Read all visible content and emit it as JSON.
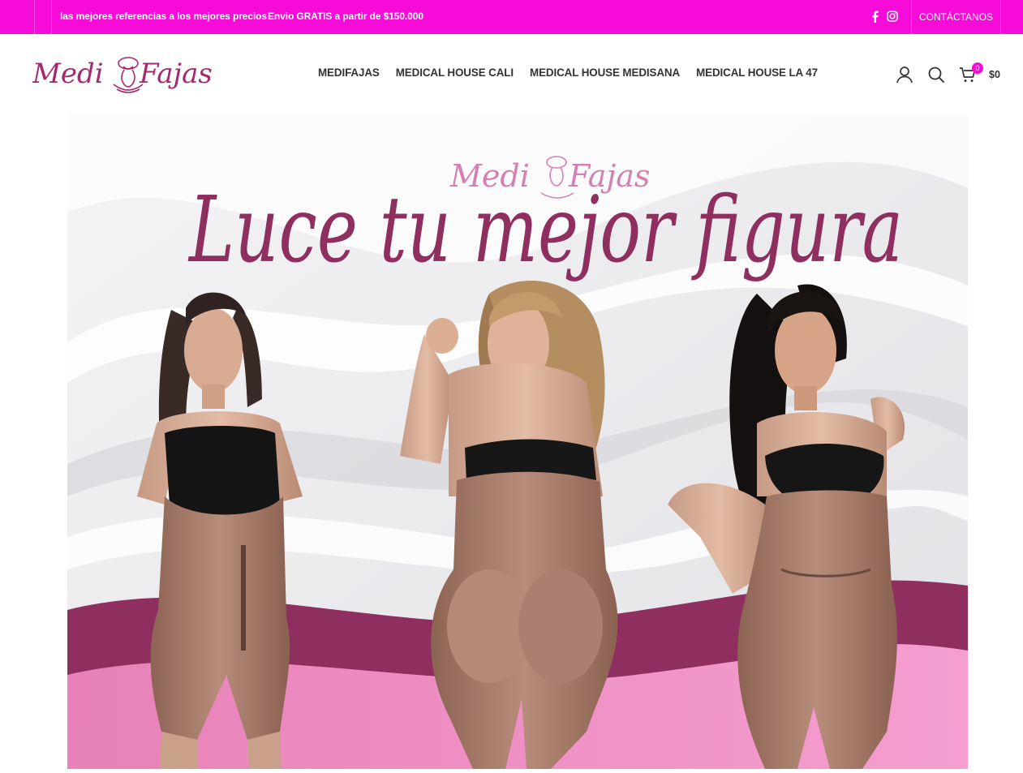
{
  "topbar": {
    "promo_left": "las mejores referencias a los mejores precios",
    "promo_right": "Envio GRATIS a partir de $150.000",
    "social": [
      "facebook-icon",
      "instagram-icon"
    ],
    "contact_label": "CONTÁCTANOS",
    "background": "#f70bd9"
  },
  "header": {
    "logo_text_left": "Medi",
    "logo_text_right": "Fajas",
    "nav": [
      {
        "label": "MEDIFAJAS"
      },
      {
        "label": "MEDICAL HOUSE CALI"
      },
      {
        "label": "MEDICAL HOUSE MEDISANA"
      },
      {
        "label": "MEDICAL HOUSE LA 47"
      }
    ],
    "icons": [
      "user-icon",
      "search-icon",
      "cart-icon"
    ],
    "cart_count": "0",
    "cart_total": "$0"
  },
  "hero": {
    "brand_left": "Medi",
    "brand_right": "Fajas",
    "headline": "Luce tu mejor figura",
    "accent": "#8e2f60",
    "accent_light": "#ef85bf"
  }
}
